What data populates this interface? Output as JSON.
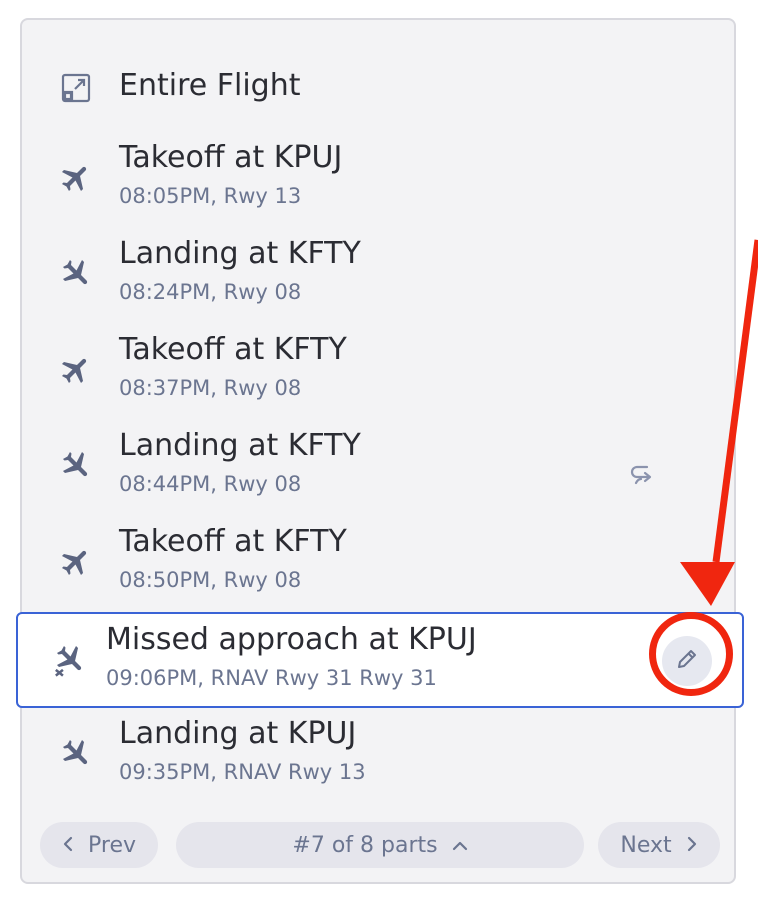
{
  "entire_flight": {
    "label": "Entire Flight",
    "icon": "expand-icon"
  },
  "items": [
    {
      "title": "Takeoff at KPUJ",
      "sub": "08:05PM, Rwy 13",
      "icon": "takeoff-icon"
    },
    {
      "title": "Landing at KFTY",
      "sub": "08:24PM, Rwy 08",
      "icon": "landing-icon"
    },
    {
      "title": "Takeoff at KFTY",
      "sub": "08:37PM, Rwy 08",
      "icon": "takeoff-icon"
    },
    {
      "title": "Landing at KFTY",
      "sub": "08:44PM, Rwy 08",
      "icon": "landing-icon",
      "action_icon": "loop-icon"
    },
    {
      "title": "Takeoff at KFTY",
      "sub": "08:50PM, Rwy 08",
      "icon": "takeoff-icon"
    },
    {
      "title": "Missed approach at KPUJ",
      "sub": "09:06PM, RNAV Rwy 31 Rwy 31",
      "icon": "missed-approach-icon",
      "selected": true,
      "action_icon": "pencil-icon"
    },
    {
      "title": "Landing at KPUJ",
      "sub": "09:35PM, RNAV Rwy 13",
      "icon": "landing-icon"
    }
  ],
  "footer": {
    "prev": "Prev",
    "parts": "#7 of 8 parts",
    "next": "Next"
  },
  "colors": {
    "panel_bg": "#f3f3f5",
    "selected_border": "#3a63d6",
    "annotation_red": "#f0260f",
    "muted_text": "#6b7590"
  }
}
